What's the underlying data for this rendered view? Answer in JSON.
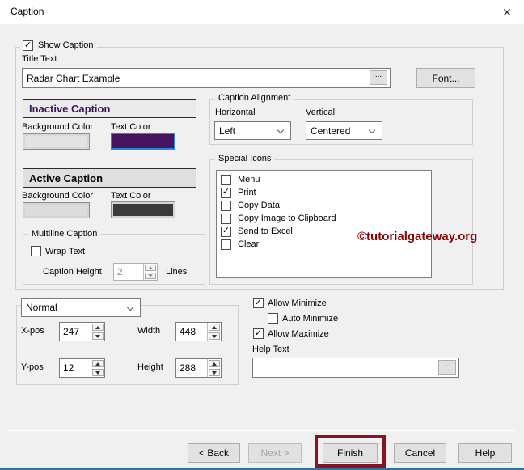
{
  "window": {
    "title": "Caption",
    "close_glyph": "✕"
  },
  "show_caption_group": {
    "label_mnemonic": "S",
    "label_rest": "how Caption",
    "checked": true,
    "title_text": {
      "label": "Title Text",
      "value": "Radar Chart Example",
      "browse": "..."
    },
    "font_button": "Font...",
    "inactive_caption": {
      "header": "Inactive Caption",
      "header_color": "#411461",
      "bg_label": "Background Color",
      "text_label": "Text Color",
      "bg_swatch_color": "#e3e3e3",
      "text_swatch_color": "#45135f",
      "focus_ring_color": "#2388d8"
    },
    "active_caption": {
      "header": "Active Caption",
      "header_color": "#000000",
      "bg_label": "Background Color",
      "text_label": "Text Color",
      "bg_swatch_color": "#dcdcdc",
      "text_swatch_color": "#3a3a3a"
    },
    "caption_alignment": {
      "label": "Caption Alignment",
      "horizontal_label": "Horizontal",
      "horizontal_value": "Left",
      "vertical_label": "Vertical",
      "vertical_value": "Centered"
    },
    "special_icons": {
      "label": "Special Icons",
      "items": [
        {
          "label": "Menu",
          "checked": false
        },
        {
          "label": "Print",
          "checked": true
        },
        {
          "label": "Copy Data",
          "checked": false
        },
        {
          "label": "Copy Image to Clipboard",
          "checked": false
        },
        {
          "label": "Send to Excel",
          "checked": true
        },
        {
          "label": "Clear",
          "checked": false
        }
      ]
    },
    "multiline_caption": {
      "label": "Multiline Caption",
      "wrap_text_label": "Wrap Text",
      "wrap_checked": false,
      "caption_height_label": "Caption Height",
      "caption_height_value": "2",
      "lines_label": "Lines"
    }
  },
  "position_group": {
    "mode_value": "Normal",
    "x_pos": {
      "label": "X-pos",
      "value": "247"
    },
    "y_pos": {
      "label": "Y-pos",
      "value": "12"
    },
    "width": {
      "label": "Width",
      "value": "448"
    },
    "height": {
      "label": "Height",
      "value": "288"
    }
  },
  "options": {
    "allow_minimize": {
      "label": "Allow Minimize",
      "checked": true
    },
    "auto_minimize": {
      "label": "Auto Minimize",
      "checked": false
    },
    "allow_maximize": {
      "label": "Allow Maximize",
      "checked": true
    },
    "help_text": {
      "label": "Help Text",
      "value": "",
      "browse": "..."
    }
  },
  "footer": {
    "back": "< Back",
    "next": "Next >",
    "finish": "Finish",
    "cancel": "Cancel",
    "help": "Help"
  },
  "watermark": {
    "text": "©tutorialgateway.org",
    "color": "#8b0000"
  },
  "annotation": {
    "highlight_color": "#871322"
  }
}
